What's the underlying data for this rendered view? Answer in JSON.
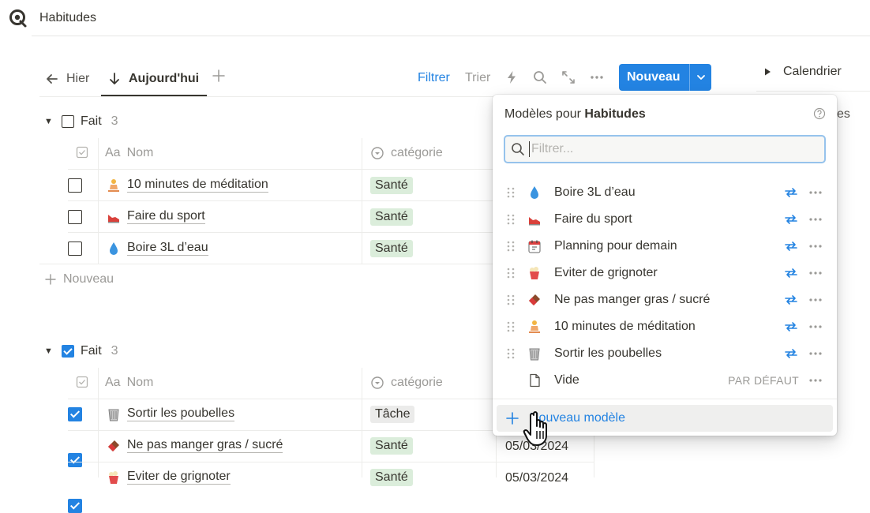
{
  "header": {
    "title": "Habitudes"
  },
  "tabs": [
    {
      "label": "Hier"
    },
    {
      "label": "Aujourd'hui"
    }
  ],
  "toolbar": {
    "filter_label": "Filtrer",
    "sort_label": "Trier",
    "new_label": "Nouveau"
  },
  "right": {
    "calendar_label": "Calendrier",
    "clipped_text": "es"
  },
  "groups": [
    {
      "label": "Fait",
      "count": "3",
      "checked": false,
      "columns": {
        "name": "Nom",
        "name_prefix": "Aa",
        "category": "catégorie"
      },
      "rows": [
        {
          "title": "10 minutes de méditation",
          "emoji": "meditation-person",
          "category": "Santé"
        },
        {
          "title": "Faire du sport",
          "emoji": "running-shoe",
          "category": "Santé"
        },
        {
          "title": "Boire 3L d’eau",
          "emoji": "droplet",
          "category": "Santé"
        }
      ],
      "new_row_label": "Nouveau"
    },
    {
      "label": "Fait",
      "count": "3",
      "checked": true,
      "columns": {
        "name": "Nom",
        "name_prefix": "Aa",
        "category": "catégorie"
      },
      "rows": [
        {
          "title": "Sortir les poubelles",
          "emoji": "wastebasket",
          "category": "Tâche",
          "date": ""
        },
        {
          "title": "Ne pas manger gras / sucré",
          "emoji": "chocolate-bar",
          "category": "Santé",
          "date": "05/03/2024"
        },
        {
          "title": "Eviter de grignoter",
          "emoji": "popcorn",
          "category": "Santé",
          "date": "05/03/2024"
        }
      ]
    }
  ],
  "popup": {
    "title_prefix": "Modèles pour",
    "title_db": "Habitudes",
    "search_placeholder": "Filtrer...",
    "templates": [
      {
        "name": "Boire 3L d’eau",
        "emoji": "droplet",
        "repeat": true
      },
      {
        "name": "Faire du sport",
        "emoji": "running-shoe",
        "repeat": true
      },
      {
        "name": "Planning pour demain",
        "emoji": "calendar",
        "repeat": true
      },
      {
        "name": "Eviter de grignoter",
        "emoji": "popcorn",
        "repeat": true
      },
      {
        "name": "Ne pas manger gras / sucré",
        "emoji": "chocolate-bar",
        "repeat": true
      },
      {
        "name": "10 minutes de méditation",
        "emoji": "meditation-person",
        "repeat": true
      },
      {
        "name": "Sortir les poubelles",
        "emoji": "wastebasket",
        "repeat": true
      },
      {
        "name": "Vide",
        "emoji": "blank-page",
        "repeat": false,
        "badge": "PAR DÉFAUT"
      }
    ],
    "new_template_label": "Nouveau modèle"
  },
  "colors": {
    "accent": "#2383e2",
    "sante_pill": "#dbeddb",
    "tache_pill": "#ebebea"
  }
}
